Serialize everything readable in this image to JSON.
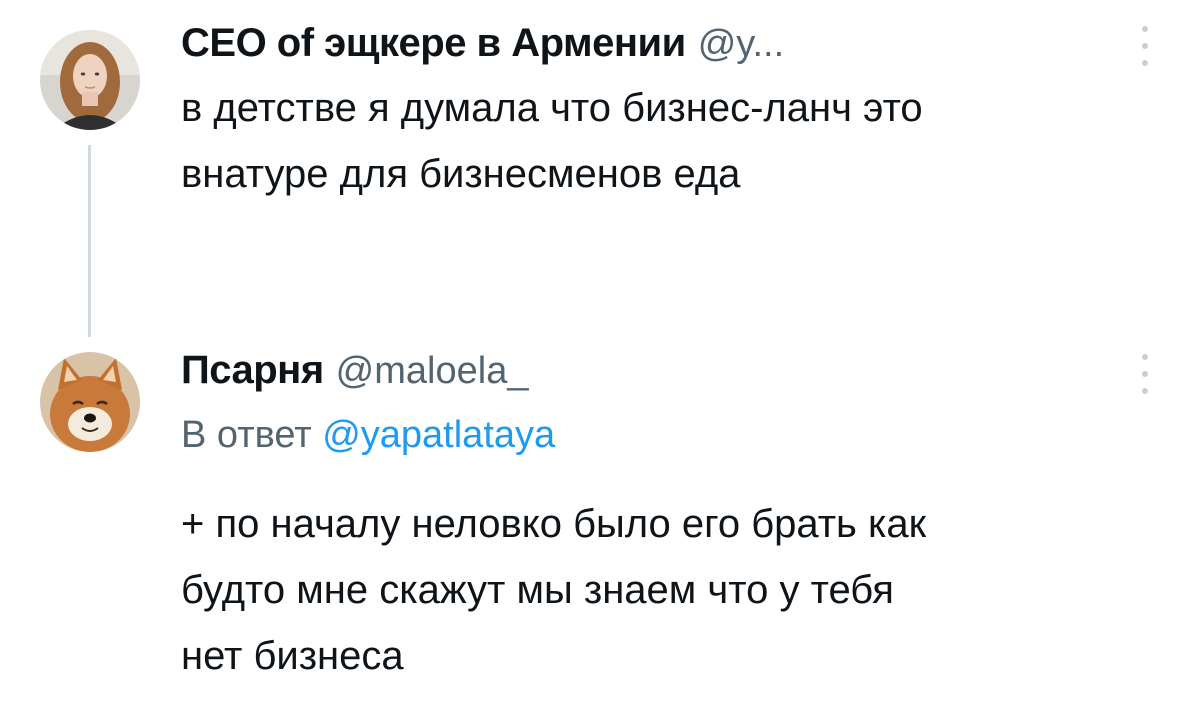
{
  "tweet1": {
    "name": "CEO of эщкере в Армении",
    "handle": "@y...",
    "text_line1": "в детстве я думала что бизнес-ланч это",
    "text_line2": "внатуре для бизнесменов еда",
    "avatar_icon": "person-avatar-icon",
    "more_icon": "more-options-icon"
  },
  "tweet2": {
    "name": "Псарня",
    "handle": "@maloela_",
    "reply_prefix": "В ответ ",
    "reply_mention": "@yapatlataya",
    "text_line1": "+ по началу неловко было его брать как",
    "text_line2": "будто мне скажут мы знаем что у тебя",
    "text_line3": "нет бизнеса",
    "avatar_icon": "shiba-dog-avatar-icon",
    "more_icon": "more-options-icon"
  },
  "colors": {
    "text": "#0f1419",
    "secondary": "#536471",
    "accent": "#1d9bf0",
    "thread_line": "#cfd9de"
  }
}
